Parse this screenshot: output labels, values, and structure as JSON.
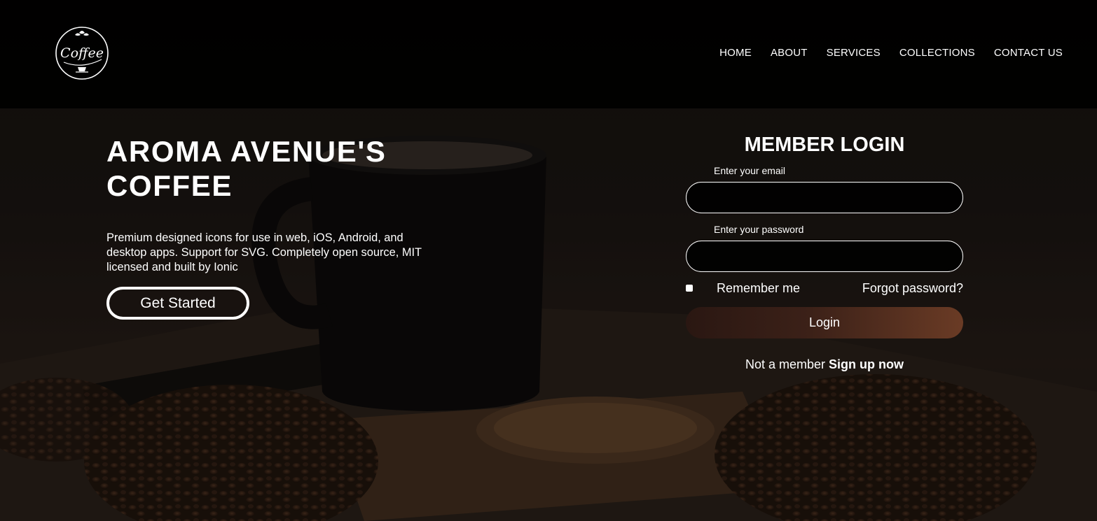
{
  "nav": {
    "logo_text": "Coffee",
    "items": [
      {
        "label": "HOME"
      },
      {
        "label": "ABOUT"
      },
      {
        "label": "SERVICES"
      },
      {
        "label": "COLLECTIONS"
      },
      {
        "label": "CONTACT US"
      }
    ]
  },
  "hero": {
    "title": "AROMA AVENUE'S COFFEE",
    "description": "Premium designed icons for use in web, iOS, Android, and desktop apps. Support for SVG. Completely open source, MIT licensed and built by Ionic",
    "cta_label": "Get Started"
  },
  "login": {
    "title": "MEMBER LOGIN",
    "email_label": "Enter your email",
    "email_value": "",
    "password_label": "Enter your password",
    "password_value": "",
    "remember_label": "Remember me",
    "remember_checked": false,
    "forgot_label": "Forgot password?",
    "submit_label": "Login",
    "signup_prefix": "Not a member",
    "signup_link": "Sign up now"
  },
  "colors": {
    "header_bg": "#000000",
    "login_button_start": "#2a1712",
    "login_button_end": "#6a3b25",
    "text": "#ffffff"
  }
}
